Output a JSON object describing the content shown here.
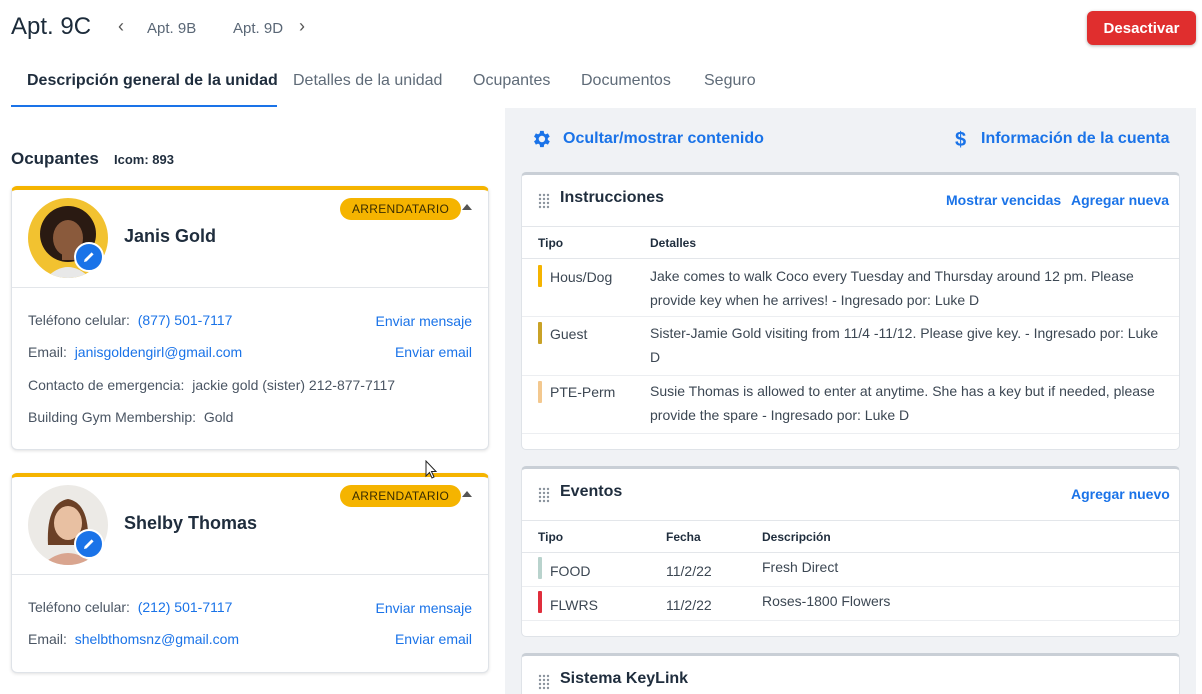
{
  "header": {
    "title": "Apt. 9C",
    "prev_apt": "Apt. 9B",
    "next_apt": "Apt. 9D",
    "deactivate_label": "Desactivar"
  },
  "tabs": [
    {
      "label": "Descripción general de la unidad",
      "active": true
    },
    {
      "label": "Detalles de la unidad",
      "active": false
    },
    {
      "label": "Ocupantes",
      "active": false
    },
    {
      "label": "Documentos",
      "active": false
    },
    {
      "label": "Seguro",
      "active": false
    }
  ],
  "occupants_section": {
    "heading": "Ocupantes",
    "icom": "Icom: 893",
    "occupants": [
      {
        "name": "Janis Gold",
        "badge": "ARRENDATARIO",
        "cell_label": "Teléfono celular:",
        "cell_value": "(877) 501-7117",
        "cell_action": "Enviar mensaje",
        "email_label": "Email:",
        "email_value": "janisgoldengirl@gmail.com",
        "email_action": "Enviar email",
        "emergency_label": "Contacto de emergencia:",
        "emergency_value": "jackie gold (sister) 212-877-7117",
        "gym_label": "Building Gym Membership:",
        "gym_value": "Gold"
      },
      {
        "name": "Shelby Thomas",
        "badge": "ARRENDATARIO",
        "cell_label": "Teléfono celular:",
        "cell_value": "(212) 501-7117",
        "cell_action": "Enviar mensaje",
        "email_label": "Email:",
        "email_value": "shelbthomsnz@gmail.com",
        "email_action": "Enviar email"
      }
    ]
  },
  "right_actions": {
    "toggle_content": "Ocultar/mostrar contenido",
    "account_info": "Información de la cuenta"
  },
  "instructions": {
    "title": "Instrucciones",
    "show_expired": "Mostrar vencidas",
    "add_new": "Agregar nueva",
    "col_type": "Tipo",
    "col_details": "Detalles",
    "rows": [
      {
        "type": "Hous/Dog",
        "details": "Jake comes to walk Coco every Tuesday and Thursday around 12 pm. Please provide key when he arrives!  - Ingresado por: Luke D",
        "color": "#f5b400"
      },
      {
        "type": "Guest",
        "details": "Sister-Jamie Gold visiting from 11/4 -11/12. Please give key.  - Ingresado por: Luke D",
        "color": "#c9a227"
      },
      {
        "type": "PTE-Perm",
        "details": "Susie Thomas is allowed to enter at anytime. She has a key but if needed, please provide the spare  - Ingresado por: Luke D",
        "color": "#f3c88f"
      }
    ]
  },
  "events": {
    "title": "Eventos",
    "add_new": "Agregar nuevo",
    "col_type": "Tipo",
    "col_date": "Fecha",
    "col_desc": "Descripción",
    "rows": [
      {
        "type": "FOOD",
        "date": "11/2/22",
        "desc": "Fresh Direct",
        "color": "#b9d3cd"
      },
      {
        "type": "FLWRS",
        "date": "11/2/22",
        "desc": "Roses-1800 Flowers",
        "color": "#e02e3c"
      }
    ]
  },
  "keylink": {
    "title": "Sistema KeyLink"
  },
  "colors": {
    "accent": "#1a73e8",
    "danger": "#e02e2e",
    "tenant_badge": "#f5b400"
  }
}
